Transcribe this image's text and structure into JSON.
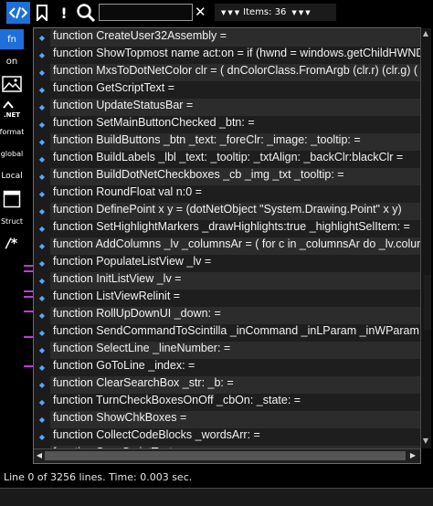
{
  "toolbar": {
    "items_label": "Items: 36",
    "search_value": "",
    "clear_label": "✕"
  },
  "sidebar": {
    "items": [
      {
        "label": "fn",
        "active": true
      },
      {
        "label": "on",
        "active": false
      },
      {
        "label": "",
        "icon": "image-icon"
      },
      {
        "label": ".NET",
        "icon": "dotnet-icon"
      },
      {
        "label": "format"
      },
      {
        "label": "global"
      },
      {
        "label": "Local"
      },
      {
        "label": "",
        "icon": "window-icon"
      },
      {
        "label": "Struct"
      },
      {
        "label": "/*",
        "icon": "comment-icon"
      }
    ]
  },
  "list": {
    "rows": [
      "function CreateUser32Assembly =",
      "function ShowTopmost name act:on = if (hwnd = windows.getChildHWND",
      "function MxsToDotNetColor clr = ( dnColorClass.FromArgb (clr.r) (clr.g) (",
      "function GetScriptText =",
      "function UpdateStatusBar =",
      "function SetMainButtonChecked _btn: =",
      "function BuildButtons _btn _text: _foreClr: _image: _tooltip: =",
      "function BuildLabels _lbl _text: _tooltip: _txtAlign: _backClr:blackClr =",
      "function BuildDotNetCheckboxes _cb _img _txt _tooltip: =",
      "function RoundFloat val n:0 =",
      "function DefinePoint x y = (dotNetObject \"System.Drawing.Point\" x y)",
      "function SetHighlightMarkers _drawHighlights:true _highlightSelItem: =",
      "function AddColumns _lv _columnsAr = ( for c in _columnsAr do _lv.colum",
      "function PopulateListView _lv =",
      "function InitListView _lv =",
      "function ListViewRelinit =",
      "function RollUpDownUI _down: =",
      "function SendCommandToScintilla _inCommand _inLParam _inWParam =",
      "function SelectLine _lineNumber: =",
      "function GoToLine _index: =",
      "function ClearSearchBox _str: _b: =",
      "function TurnCheckBoxesOnOff _cbOn: _state: =",
      "function ShowChkBoxes =",
      "function CollectCodeBlocks _wordsArr: =",
      "function ScanScriptText ="
    ]
  },
  "status": {
    "text": "Line 0 of 3256 lines. Time: 0.003 sec."
  },
  "colors": {
    "accent": "#1e6fd9",
    "row_odd": "#2c2c2c",
    "row_even": "#1e1e1e"
  }
}
